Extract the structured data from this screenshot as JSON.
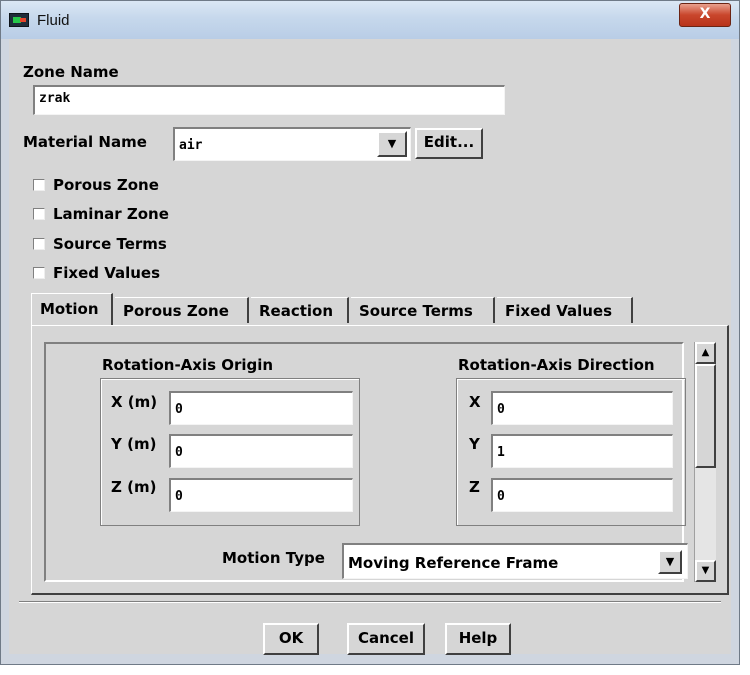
{
  "window": {
    "title": "Fluid",
    "close_glyph": "X"
  },
  "zone": {
    "label": "Zone Name",
    "value": "zrak"
  },
  "material": {
    "label": "Material Name",
    "value": "air",
    "edit_label": "Edit..."
  },
  "checkboxes": [
    {
      "label": "Porous Zone",
      "checked": false
    },
    {
      "label": "Laminar Zone",
      "checked": false
    },
    {
      "label": "Source Terms",
      "checked": false
    },
    {
      "label": "Fixed Values",
      "checked": false
    }
  ],
  "tabs": [
    "Motion",
    "Porous Zone",
    "Reaction",
    "Source Terms",
    "Fixed Values"
  ],
  "active_tab": "Motion",
  "origin": {
    "title": "Rotation-Axis Origin",
    "x_label": "X (m)",
    "x_value": "0",
    "y_label": "Y (m)",
    "y_value": "0",
    "z_label": "Z (m)",
    "z_value": "0"
  },
  "direction": {
    "title": "Rotation-Axis Direction",
    "x_label": "X",
    "x_value": "0",
    "y_label": "Y",
    "y_value": "1",
    "z_label": "Z",
    "z_value": "0"
  },
  "motion_type": {
    "label": "Motion Type",
    "value": "Moving Reference Frame"
  },
  "buttons": {
    "ok": "OK",
    "cancel": "Cancel",
    "help": "Help"
  },
  "colors": {
    "dialog_bg": "#d6d6d6",
    "close_button": "#c9462c",
    "title_bar": "#c6d8ec"
  }
}
